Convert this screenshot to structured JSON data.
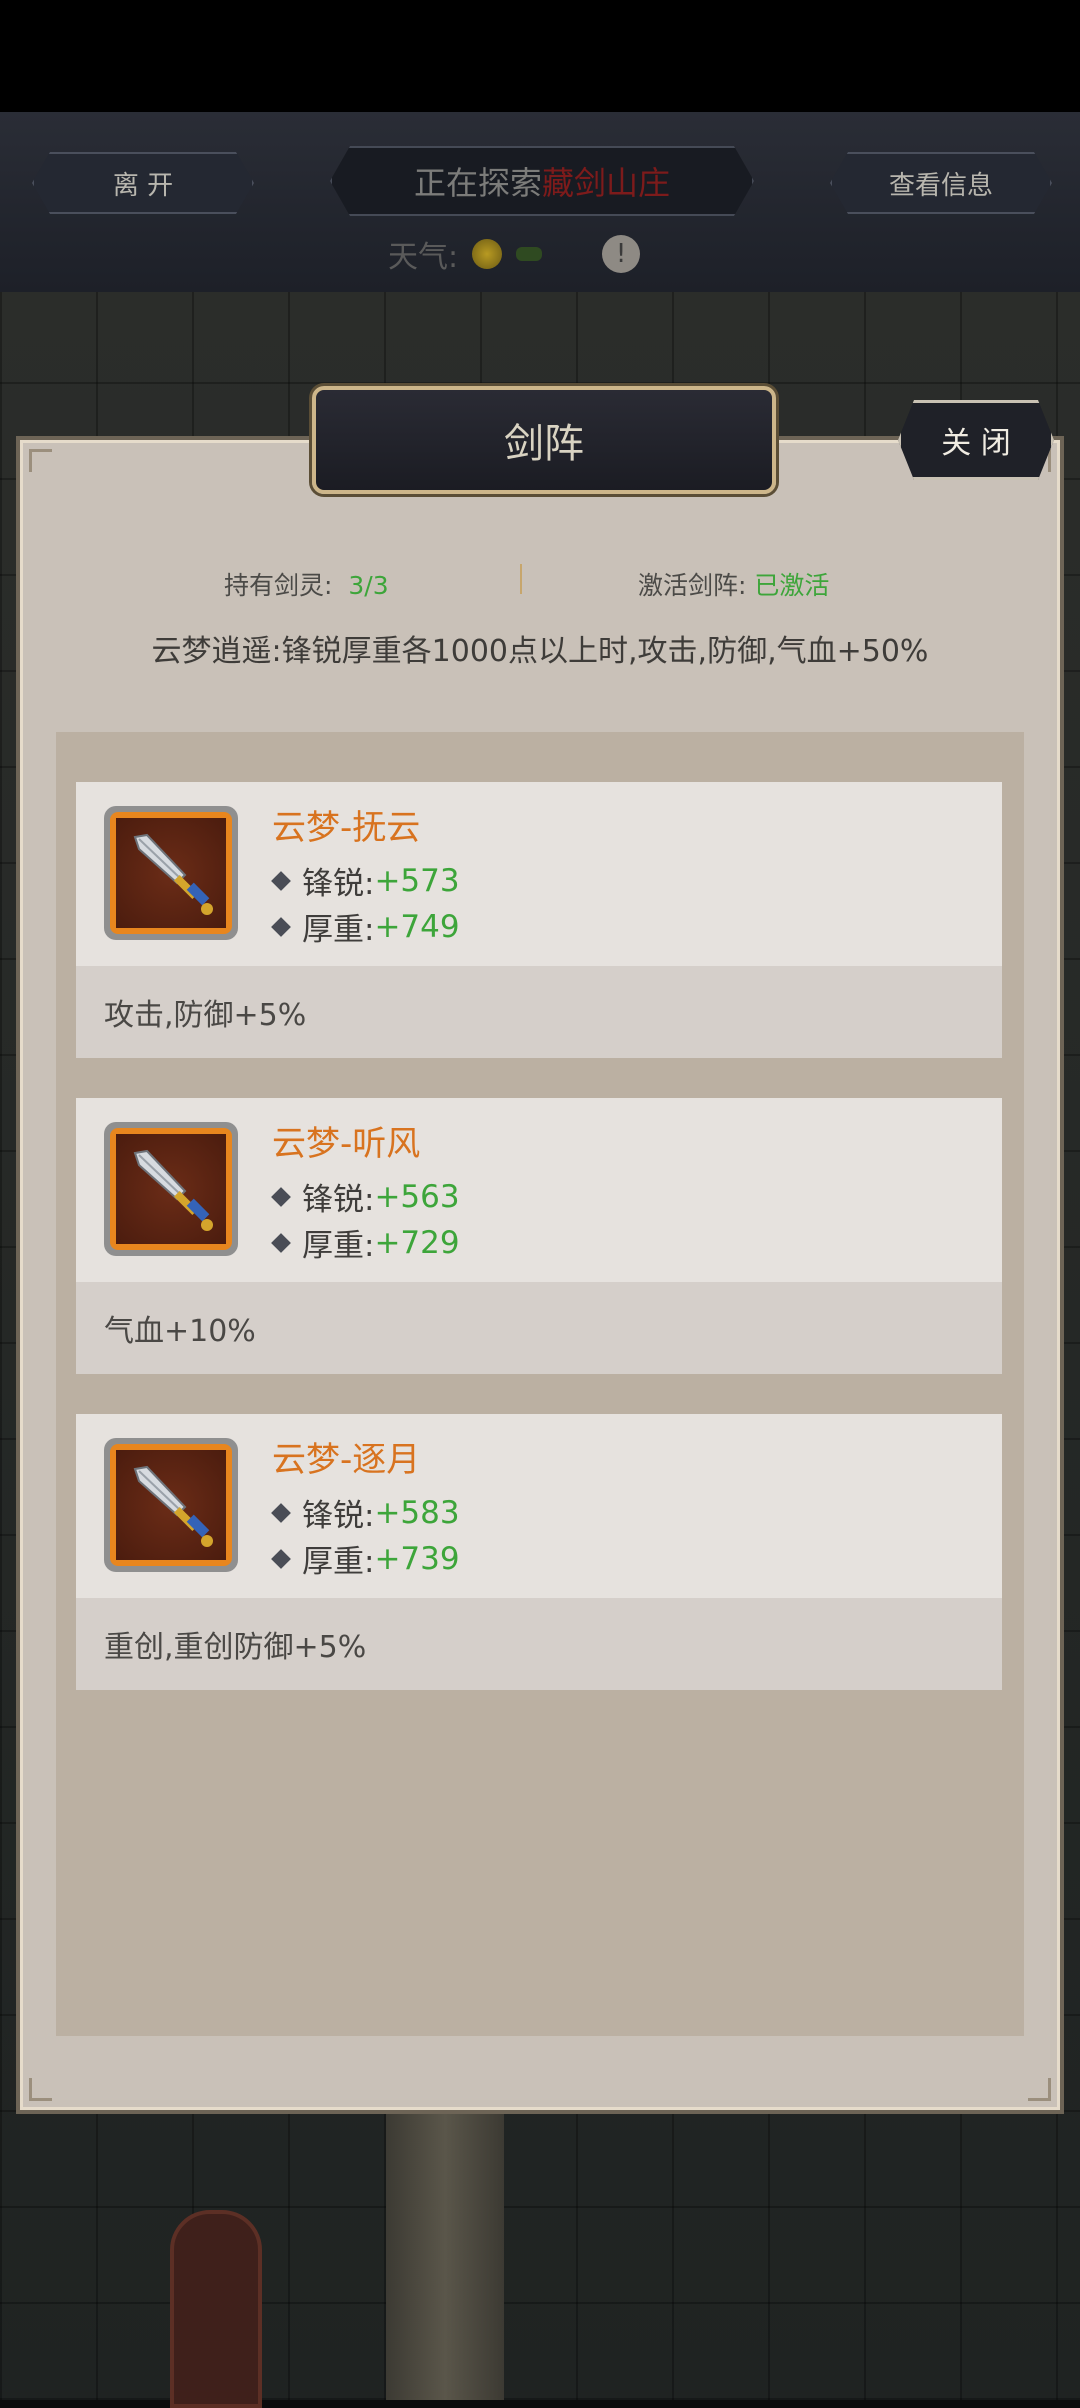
{
  "hud": {
    "leave_label": "离 开",
    "exploring_prefix": "正在探索",
    "location": "藏剑山庄",
    "view_info_label": "查看信息",
    "weather_label": "天气:",
    "info_symbol": "!"
  },
  "panel": {
    "title": "剑阵",
    "close_label": "关 闭",
    "held_label": "持有剑灵:",
    "held_value": "3/3",
    "active_label": "激活剑阵:",
    "active_value": "已激活",
    "bonus_text": "云梦逍遥:锋锐厚重各1000点以上时,攻击,防御,气血+50%"
  },
  "sword_spirits": [
    {
      "name": "云梦-抚云",
      "sharp_label": "锋锐:",
      "sharp_value": "+573",
      "heavy_label": "厚重:",
      "heavy_value": "+749",
      "effect": "攻击,防御+5%"
    },
    {
      "name": "云梦-听风",
      "sharp_label": "锋锐:",
      "sharp_value": "+563",
      "heavy_label": "厚重:",
      "heavy_value": "+729",
      "effect": "气血+10%"
    },
    {
      "name": "云梦-逐月",
      "sharp_label": "锋锐:",
      "sharp_value": "+583",
      "heavy_label": "厚重:",
      "heavy_value": "+739",
      "effect": "重创,重创防御+5%"
    }
  ],
  "colors": {
    "accent_orange": "#d8731f",
    "value_green": "#3da53a",
    "panel_bg": "#c9c1b8"
  }
}
